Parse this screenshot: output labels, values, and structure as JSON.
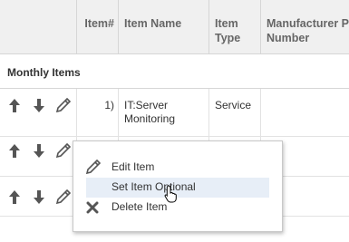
{
  "columns": {
    "item_number": "Item#",
    "item_name": "Item Name",
    "item_type": "Item Type",
    "manufacturer": "Manufacturer P Number"
  },
  "section_title": "Monthly Items",
  "rows": [
    {
      "number": "1)",
      "name": "IT:Server Monitoring",
      "type": "Service"
    },
    {
      "number": "",
      "name": "",
      "type": ""
    },
    {
      "number": "",
      "name": "",
      "type": ""
    }
  ],
  "icons": {
    "move_up": "arrow-up-icon",
    "move_down": "arrow-down-icon",
    "edit": "pencil-icon"
  },
  "context_menu": {
    "items": [
      {
        "label": "Edit Item",
        "icon": "pencil-icon"
      },
      {
        "label": "Set Item Optional",
        "icon": ""
      },
      {
        "label": "Delete Item",
        "icon": "close-icon"
      }
    ],
    "highlighted_index": 1
  },
  "colors": {
    "header_bg": "#f0f0f0",
    "icon_gray": "#555555",
    "menu_highlight": "#e7eef7"
  }
}
